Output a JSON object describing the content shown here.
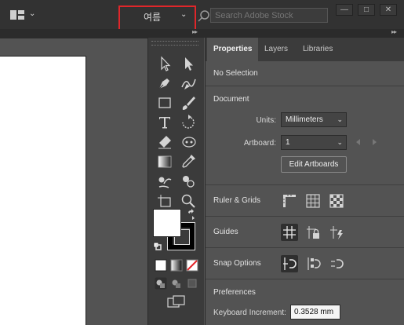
{
  "topbar": {
    "workspace_label": "여름",
    "stock_placeholder": "Search Adobe Stock"
  },
  "panel": {
    "tabs": [
      {
        "label": "Properties",
        "active": true
      },
      {
        "label": "Layers",
        "active": false
      },
      {
        "label": "Libraries",
        "active": false
      }
    ],
    "selection_status": "No Selection",
    "document": {
      "title": "Document",
      "units_label": "Units:",
      "units_value": "Millimeters",
      "artboard_label": "Artboard:",
      "artboard_value": "1",
      "edit_button": "Edit Artboards"
    },
    "ruler_grids": {
      "title": "Ruler & Grids"
    },
    "guides": {
      "title": "Guides"
    },
    "snap": {
      "title": "Snap Options"
    },
    "preferences": {
      "title": "Preferences",
      "keyboard_label": "Keyboard Increment:",
      "keyboard_value": "0.3528 mm"
    }
  },
  "colors": {
    "highlight_border": "#e0262a",
    "panel_bg": "#535353",
    "toolbar_bg": "#3b3b3b",
    "topbar_bg": "#323232"
  }
}
